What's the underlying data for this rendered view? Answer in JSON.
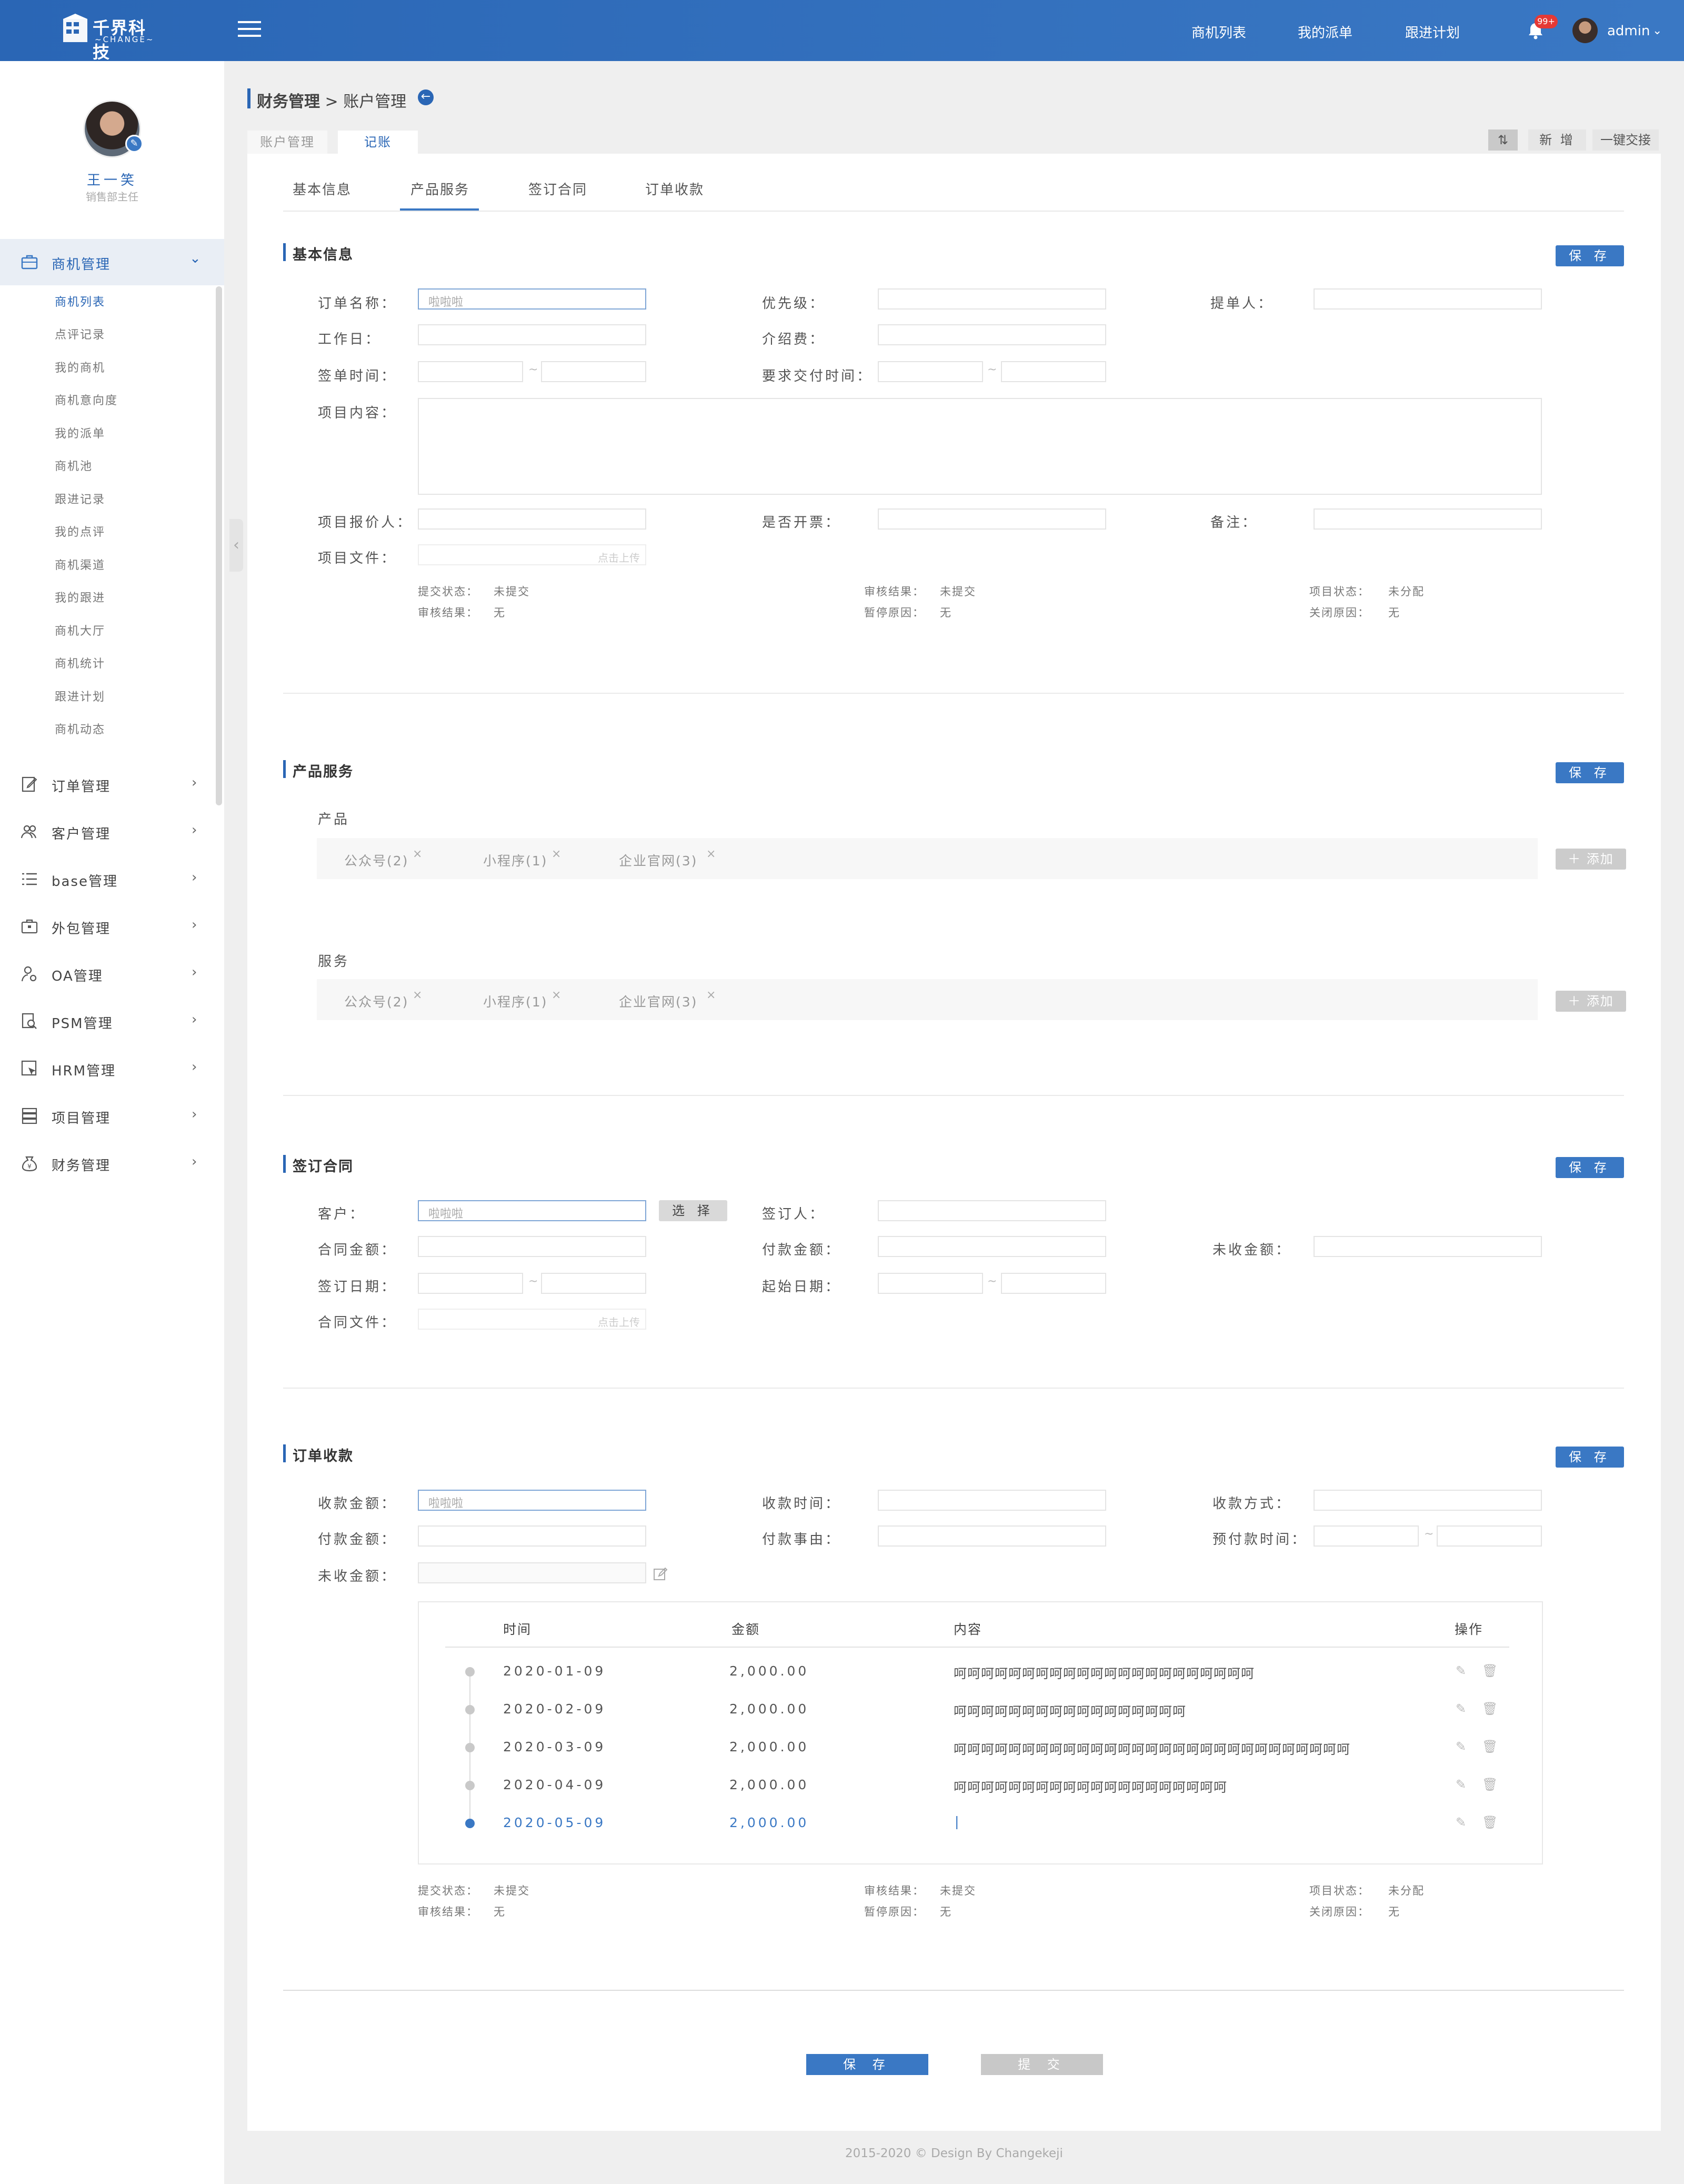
{
  "header": {
    "logo_text": "千界科技",
    "logo_sub": "~CHANGE~",
    "nav": [
      "商机列表",
      "我的派单",
      "跟进计划"
    ],
    "badge": "99+",
    "user": "admin"
  },
  "profile": {
    "name": "王一笑",
    "role": "销售部主任"
  },
  "sidebar": {
    "active_group": "商机管理",
    "sub_items": [
      "商机列表",
      "点评记录",
      "我的商机",
      "商机意向度",
      "我的派单",
      "商机池",
      "跟进记录",
      "我的点评",
      "商机渠道",
      "我的跟进",
      "商机大厅",
      "商机统计",
      "跟进计划",
      "商机动态"
    ],
    "groups": [
      "订单管理",
      "客户管理",
      "base管理",
      "外包管理",
      "OA管理",
      "PSM管理",
      "HRM管理",
      "项目管理",
      "财务管理"
    ]
  },
  "breadcrumb": {
    "parent": "财务管理",
    "sep": " > ",
    "current": "账户管理"
  },
  "page_tabs": [
    "账户管理",
    "记账"
  ],
  "toolbar": {
    "new": "新 增",
    "handover": "一键交接"
  },
  "inner_tabs": [
    "基本信息",
    "产品服务",
    "签订合同",
    "订单收款"
  ],
  "save_label": "保 存",
  "basic": {
    "title": "基本信息",
    "order_name_label": "订单名称：",
    "order_name_value": "啦啦啦",
    "priority_label": "优先级：",
    "submitter_label": "提单人：",
    "workday_label": "工作日：",
    "intro_fee_label": "介绍费：",
    "sign_time_label": "签单时间：",
    "delivery_label": "要求交付时间：",
    "content_label": "项目内容：",
    "quoter_label": "项目报价人：",
    "open_label": "是否开票：",
    "note_label": "备注：",
    "file_label": "项目文件：",
    "upload_hint": "点击上传"
  },
  "status": {
    "submit_label": "提交状态：",
    "submit_value": "未提交",
    "review_label": "审核结果：",
    "review_value": "未提交",
    "project_label": "项目状态：",
    "project_value": "未分配",
    "review2_label": "审核结果：",
    "review2_value": "无",
    "pause_label": "暂停原因：",
    "pause_value": "无",
    "close_label": "关闭原因：",
    "close_value": "无"
  },
  "product": {
    "title": "产品服务",
    "product_label": "产品",
    "service_label": "服务",
    "chips": [
      "公众号(2)",
      "小程序(1)",
      "企业官网(3)"
    ],
    "chip_close": "×",
    "add": "添加"
  },
  "contract": {
    "title": "签订合同",
    "customer_label": "客户：",
    "customer_value": "啦啦啦",
    "choose": "选 择",
    "signer_label": "签订人：",
    "amount_label": "合同金额：",
    "paid_label": "付款金额：",
    "unpaid_label": "未收金额：",
    "sign_date_label": "签订日期：",
    "start_label": "起始日期：",
    "file_label": "合同文件：",
    "upload_hint": "点击上传"
  },
  "receipt": {
    "title": "订单收款",
    "amount_label": "收款金额：",
    "amount_value": "啦啦啦",
    "time_label": "收款时间：",
    "method_label": "收款方式：",
    "pay_label": "付款金额：",
    "reason_label": "付款事由：",
    "prepay_label": "预付款时间：",
    "unpaid_label": "未收金额："
  },
  "table": {
    "headers": [
      "时间",
      "金额",
      "内容",
      "操作"
    ],
    "rows": [
      {
        "date": "2020-01-09",
        "amount": "2,000.00",
        "content": "呵呵呵呵呵呵呵呵呵呵呵呵呵呵呵呵呵呵呵呵呵呵"
      },
      {
        "date": "2020-02-09",
        "amount": "2,000.00",
        "content": "呵呵呵呵呵呵呵呵呵呵呵呵呵呵呵呵呵"
      },
      {
        "date": "2020-03-09",
        "amount": "2,000.00",
        "content": "呵呵呵呵呵呵呵呵呵呵呵呵呵呵呵呵呵呵呵呵呵呵呵呵呵呵呵呵呵"
      },
      {
        "date": "2020-04-09",
        "amount": "2,000.00",
        "content": "呵呵呵呵呵呵呵呵呵呵呵呵呵呵呵呵呵呵呵呵"
      },
      {
        "date": "2020-05-09",
        "amount": "2,000.00",
        "content": "|"
      }
    ]
  },
  "footer_buttons": {
    "save": "保 存",
    "submit": "提 交"
  },
  "footer": "2015-2020 © Design By Changekeji"
}
